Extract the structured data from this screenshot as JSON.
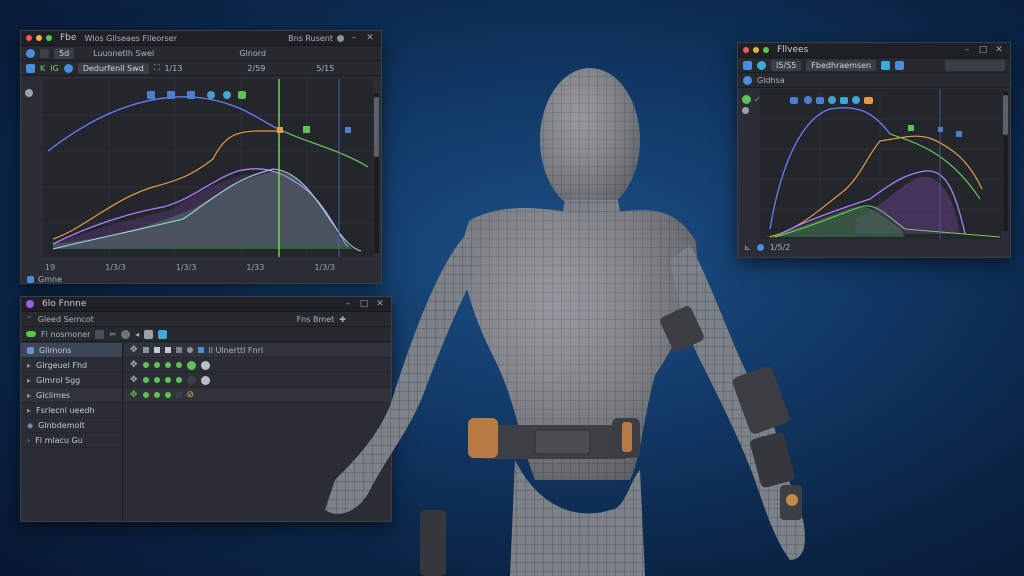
{
  "graph_editor_left": {
    "title": "Fbe",
    "menu": "Wlos Gllseaes  Flleorser",
    "right_menu": "Bns Rusent",
    "search_field": "Dedurfenil Swd",
    "field_value": "5d",
    "frame_start": "1/13",
    "frame_current": "2/59",
    "frame_end": "5/15",
    "channel_label": "Glnord",
    "inner_label": "Luuonetlh Swel",
    "timeline_ticks": [
      "19",
      "1/3/3",
      "1/3/3",
      "1/33",
      "1/3/3"
    ],
    "footer_label": "Gmne",
    "colors": {
      "purple": "#b27cff",
      "orange": "#e59a45",
      "green": "#6fcf5a",
      "teal": "#9fd9d0",
      "blue": "#6c7cff",
      "playhead": "#7ed957"
    }
  },
  "outliner_panel": {
    "title": "6lo Fnnne",
    "subtitle": "Gleed Semcot",
    "right_menu": "Fns Bmet",
    "toolbar_label": "Fl nosmoner",
    "track_header": "ll Ulnerttl Fnrl",
    "items": [
      {
        "label": "Glimons",
        "icon": "square-icon",
        "selected": true
      },
      {
        "label": "Glrgeuel Fhd",
        "icon": "triangle-right-icon",
        "selected": false
      },
      {
        "label": "Glmrol Sgg",
        "icon": "triangle-right-icon",
        "selected": false
      },
      {
        "label": "Glclimes",
        "icon": "triangle-right-icon",
        "selected": false
      },
      {
        "label": "Fsrlecnl ueedh",
        "icon": "triangle-right-icon",
        "selected": false
      },
      {
        "label": "Glnbdemolt",
        "icon": "diamond-icon",
        "selected": false
      },
      {
        "label": "Fl mlacu Gu",
        "icon": "chevron-right-icon",
        "selected": false
      }
    ]
  },
  "graph_editor_right": {
    "title": "Fllvees",
    "search_field": "Fbedhraemsen",
    "field_value": "I5/S5",
    "channel_label": "Gldhsa",
    "footer_frame": "1/5/2",
    "colors": {
      "purple": "#b27cff",
      "orange": "#e59a45",
      "green": "#6fcf5a",
      "blue": "#6c7cff"
    }
  }
}
